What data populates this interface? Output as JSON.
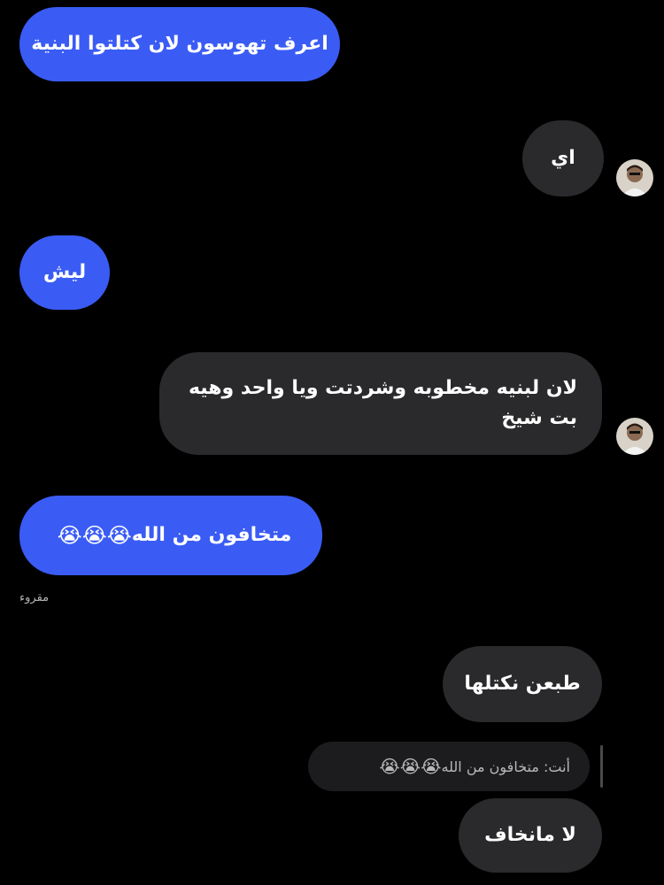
{
  "messages": [
    {
      "id": "m1",
      "side": "sent",
      "text": "اعرف تهوسون لان كتلتوا البنية"
    },
    {
      "id": "m2",
      "side": "received",
      "text": "اي"
    },
    {
      "id": "m3",
      "side": "sent",
      "text": "ليش"
    },
    {
      "id": "m4",
      "side": "received",
      "text": "لان لبنيه مخطوبه وشردتت ويا واحد وهيه بت شيخ"
    },
    {
      "id": "m5",
      "side": "sent",
      "text": "متخافون من الله",
      "emoji": "😭😭😭"
    },
    {
      "id": "m6",
      "side": "received",
      "text": "طبعن نكتلها"
    },
    {
      "id": "m7",
      "side": "received",
      "text": "لا مانخاف"
    }
  ],
  "read_receipt": "مقروء",
  "reply_preview": {
    "text": "أنت: متخافون من الله",
    "emoji": "😭😭😭"
  },
  "avatar_icon": "user-avatar-icon",
  "colors": {
    "background": "#000000",
    "sent_bubble": "#3a5cf5",
    "received_bubble": "#2a2a2c"
  }
}
